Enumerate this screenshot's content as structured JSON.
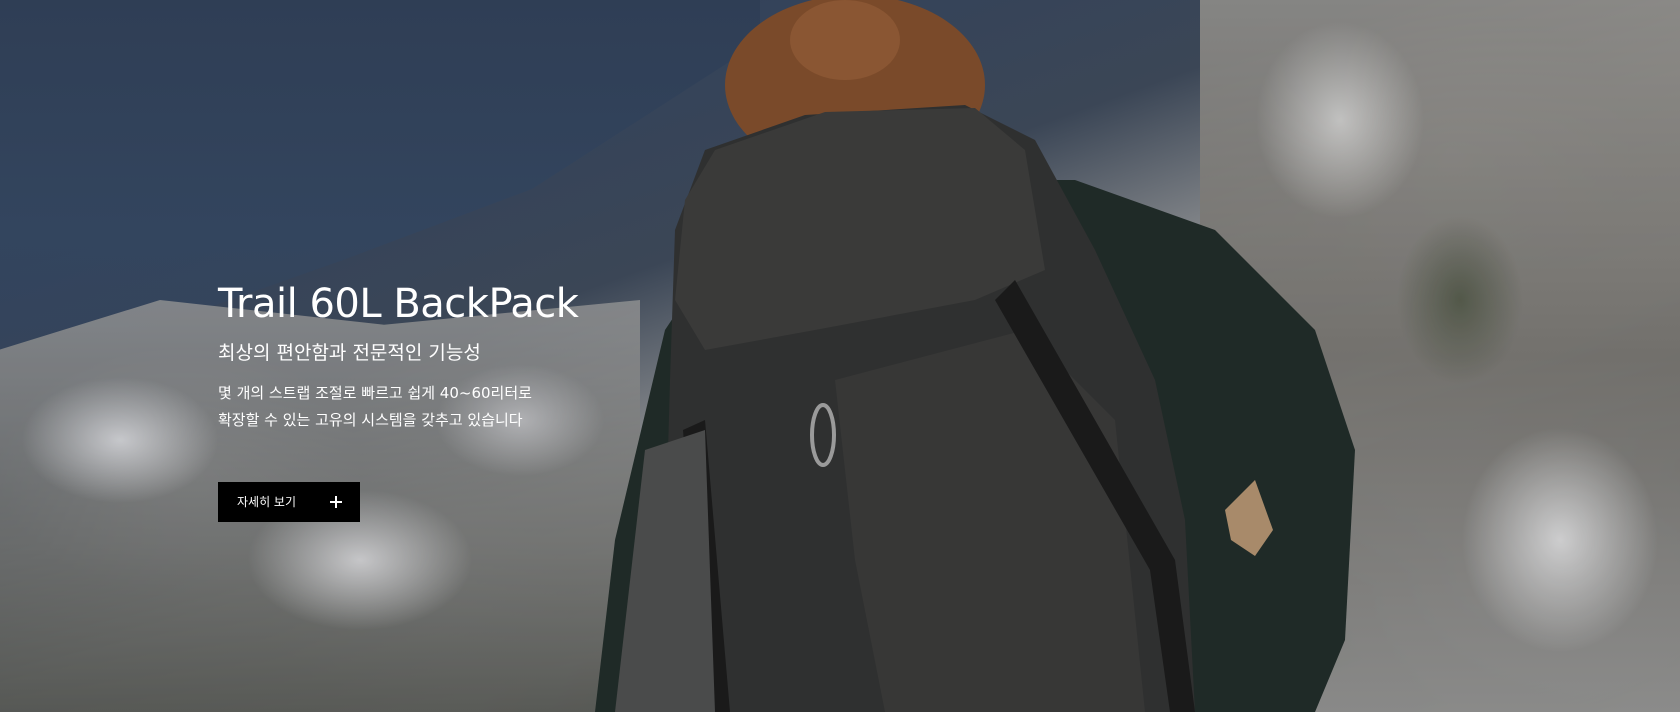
{
  "hero": {
    "title": "Trail 60L BackPack",
    "subtitle": "최상의 편안함과 전문적인 기능성",
    "description_lines": [
      "몇 개의 스트랩 조절로 빠르고 쉽게 40~60리터로",
      "확장할 수 있는 고유의 시스템을 갖추고 있습니다"
    ],
    "cta": {
      "label": "자세히 보기",
      "icon": "plus-icon"
    },
    "background_image": "hiker-with-backpack-on-mountain-photo"
  },
  "colors": {
    "text": "#ffffff",
    "button_bg": "#000000",
    "button_text": "#ffffff"
  }
}
